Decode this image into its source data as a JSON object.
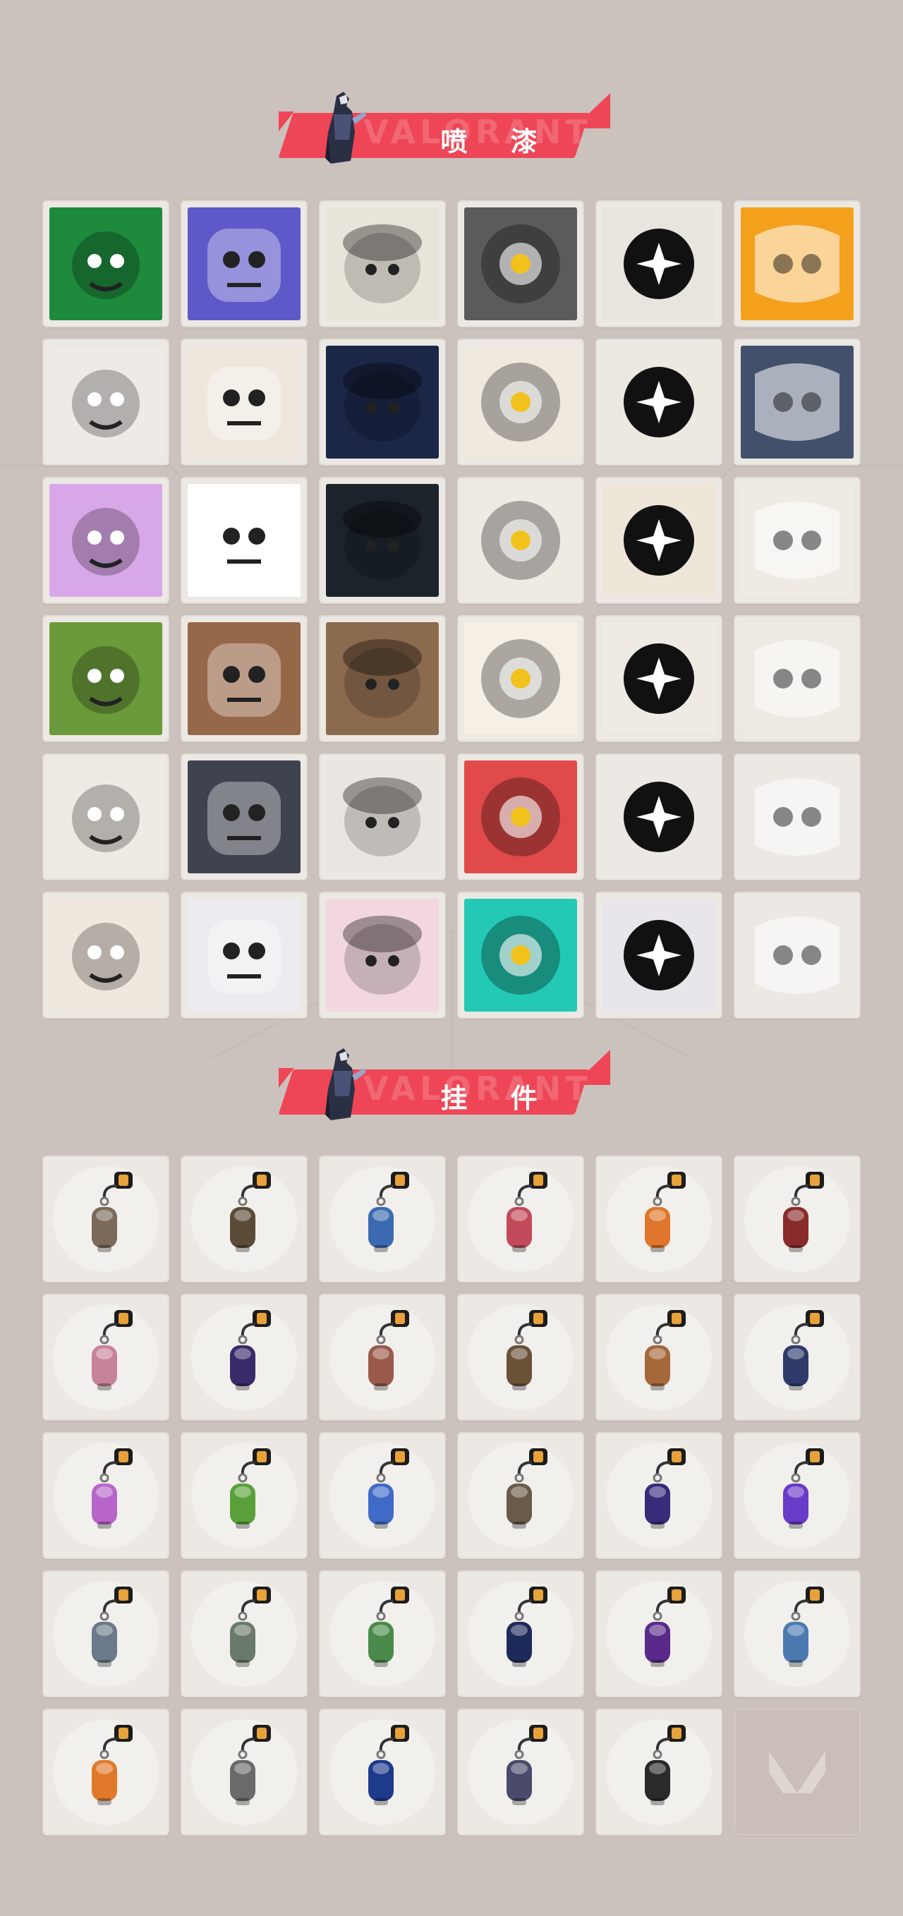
{
  "sections": {
    "sprays": {
      "title": "喷 漆",
      "ghost": "VALORANT",
      "items": [
        {
          "name": "gas-mask-soldier-spray",
          "bg": "#1e8a3c"
        },
        {
          "name": "purple-robot-spray",
          "bg": "#5e58c8"
        },
        {
          "name": "beanie-bird-spray",
          "bg": "#e9e4da"
        },
        {
          "name": "robot-head-spray",
          "bg": "#5b5b5b"
        },
        {
          "name": "black-sparkle-spray",
          "bg": "#e8e4de"
        },
        {
          "name": "orange-pattern-spray",
          "bg": "#f3a11c"
        },
        {
          "name": "purple-scribble-spray",
          "bg": "#eeeae6"
        },
        {
          "name": "goggles-dog-spray",
          "bg": "#efe7dd"
        },
        {
          "name": "chevron-stripes-spray",
          "bg": "#1c2646"
        },
        {
          "name": "sleepy-cat-spray",
          "bg": "#efe9de"
        },
        {
          "name": "pixel-agent-spray",
          "bg": "#ede8e0"
        },
        {
          "name": "masked-ninja-spray",
          "bg": "#43506c"
        },
        {
          "name": "dizzy-purple-spray",
          "bg": "#d8a7e8"
        },
        {
          "name": "clown-face-spray",
          "bg": "#ffffff"
        },
        {
          "name": "orange-dial-spray",
          "bg": "#1c232b"
        },
        {
          "name": "raccoon-spray",
          "bg": "#efeae2"
        },
        {
          "name": "bearded-agent-spray",
          "bg": "#efe6da"
        },
        {
          "name": "bandaid-kid-spray",
          "bg": "#efeae4"
        },
        {
          "name": "green-crate-spray",
          "bg": "#6a9a3a"
        },
        {
          "name": "green-eyes-spray",
          "bg": "#96684a"
        },
        {
          "name": "crying-mole-spray",
          "bg": "#8c6a4e"
        },
        {
          "name": "tiger-cub-spray",
          "bg": "#f5efe6"
        },
        {
          "name": "angry-girl-spray",
          "bg": "#efeae4"
        },
        {
          "name": "beanie-penguin-spray",
          "bg": "#ede9e3"
        },
        {
          "name": "top-hat-frog-spray",
          "bg": "#efeae4"
        },
        {
          "name": "grinning-cat-spray",
          "bg": "#3f434f"
        },
        {
          "name": "hooded-agent-spray",
          "bg": "#e9e5e0"
        },
        {
          "name": "score-ii0-spray",
          "bg": "#e04a4a"
        },
        {
          "name": "green-slime-spray",
          "bg": "#ece8e4"
        },
        {
          "name": "red-x-button-spray",
          "bg": "#ece8e4"
        },
        {
          "name": "dragon-critter-spray",
          "bg": "#f0e8df"
        },
        {
          "name": "blue-hair-agent-spray",
          "bg": "#ecebef"
        },
        {
          "name": "neon-heart-spray",
          "bg": "#f2d7e0"
        },
        {
          "name": "valorant-logo-splash-spray",
          "bg": "#23c9b4"
        },
        {
          "name": "graffiti-tag-spray",
          "bg": "#e8e6ea"
        },
        {
          "name": "red-mask-spray",
          "bg": "#ece8e4"
        }
      ]
    },
    "buddies": {
      "title": "挂 件",
      "ghost": "VALORANT",
      "items": [
        {
          "name": "raccoon-warrior-buddy",
          "color": "#7b6a5a"
        },
        {
          "name": "round-bottle-buddy",
          "color": "#5a4a36"
        },
        {
          "name": "blue-canister-buddy",
          "color": "#3b6ab0"
        },
        {
          "name": "red-sword-buddy",
          "color": "#c24a5a"
        },
        {
          "name": "fire-lizard-buddy",
          "color": "#e0762c"
        },
        {
          "name": "braided-cord-buddy",
          "color": "#8a2b2b"
        },
        {
          "name": "cupcake-buddy",
          "color": "#c7839a"
        },
        {
          "name": "ep9-medal-buddy",
          "color": "#3a2a6a"
        },
        {
          "name": "teddy-bear-buddy",
          "color": "#9a5a4a"
        },
        {
          "name": "pistol-buddy",
          "color": "#6a5238"
        },
        {
          "name": "cardboard-box-buddy",
          "color": "#a4683a"
        },
        {
          "name": "tassel-figure-buddy",
          "color": "#2e3b6a"
        },
        {
          "name": "lava-lamp-buddy",
          "color": "#b865c9"
        },
        {
          "name": "green-pager-buddy",
          "color": "#5aa03a"
        },
        {
          "name": "astronaut-buddy",
          "color": "#3f6ac8"
        },
        {
          "name": "radio-buddy",
          "color": "#6a5a4a"
        },
        {
          "name": "ep9-medal-2-buddy",
          "color": "#3a2a7a"
        },
        {
          "name": "pixel-heart-buddy",
          "color": "#6a3ac8"
        },
        {
          "name": "agent-card-buddy",
          "color": "#6a7a8a"
        },
        {
          "name": "potted-plant-buddy",
          "color": "#6a7a6a"
        },
        {
          "name": "green-can-buddy",
          "color": "#4a8a4a"
        },
        {
          "name": "ep9-medal-3-buddy",
          "color": "#1e2a5a"
        },
        {
          "name": "ep8-medal-buddy",
          "color": "#5a2a8a"
        },
        {
          "name": "ufo-buddy",
          "color": "#4a7ab0"
        },
        {
          "name": "orange-cat-buddy",
          "color": "#e07a2a"
        },
        {
          "name": "grey-cat-buddy",
          "color": "#6a6a6a"
        },
        {
          "name": "ep8-medal-2-buddy",
          "color": "#1e3a8a"
        },
        {
          "name": "jade-tassel-buddy",
          "color": "#4a4a6a"
        },
        {
          "name": "v-coin-buddy",
          "color": "#2a2a2a"
        }
      ]
    }
  }
}
